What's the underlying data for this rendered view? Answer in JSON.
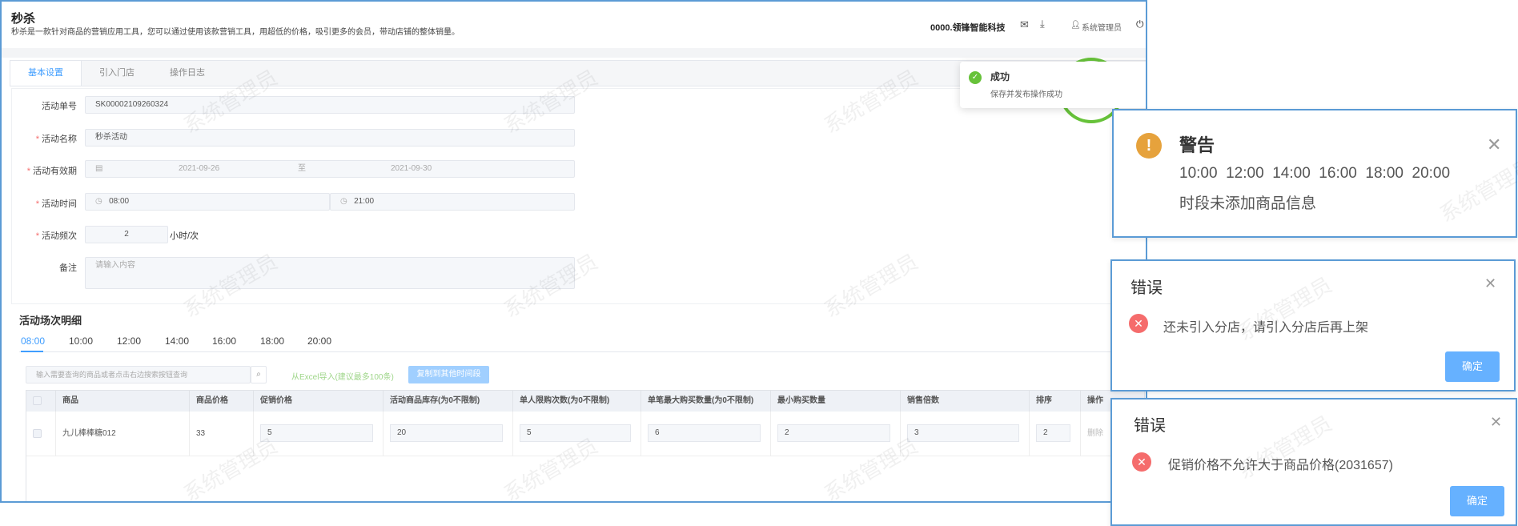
{
  "header": {
    "title": "秒杀",
    "subtitle": "秒杀是一款针对商品的营销应用工具，您可以通过使用该款营销工具，用超低的价格，吸引更多的会员，带动店铺的整体销量。",
    "company": "0000.领锋智能科技",
    "user": "系统管理员"
  },
  "tabs": [
    {
      "label": "基本设置"
    },
    {
      "label": "引入门店"
    },
    {
      "label": "操作日志"
    }
  ],
  "form": {
    "order_no_label": "活动单号",
    "order_no": "SK00002109260324",
    "name_label": "活动名称",
    "name": "秒杀活动",
    "period_label": "活动有效期",
    "start_date": "2021-09-26",
    "to": "至",
    "end_date": "2021-09-30",
    "time_label": "活动时间",
    "start_time": "08:00",
    "end_time": "21:00",
    "freq_label": "活动频次",
    "freq": "2",
    "freq_unit": "小时/次",
    "remark_label": "备注",
    "remark_placeholder": "请输入内容",
    "required_mark": "*"
  },
  "section": {
    "title": "活动场次明细",
    "time_tabs": [
      "08:00",
      "10:00",
      "12:00",
      "14:00",
      "16:00",
      "18:00",
      "20:00"
    ],
    "search_placeholder": "输入需要查询的商品或者点击右边搜索按钮查询",
    "excel_import": "从Excel导入(建议最多100条)",
    "copy_button": "复制到其他时间段"
  },
  "table": {
    "columns": [
      "商品",
      "商品价格",
      "促销价格",
      "活动商品库存(为0不限制)",
      "单人限购次数(为0不限制)",
      "单笔最大购买数量(为0不限制)",
      "最小购买数量",
      "销售倍数",
      "排序",
      "操作"
    ],
    "rows": [
      {
        "product": "九儿棒棒糖012",
        "price": "33",
        "promo_price": "5",
        "stock": "20",
        "per_user_limit": "5",
        "max_per_order": "6",
        "min_qty": "2",
        "multiple": "3",
        "sort": "2",
        "action": "删除"
      }
    ]
  },
  "watermark": "系统管理员",
  "toast": {
    "title": "成功",
    "message": "保存并发布操作成功"
  },
  "warning": {
    "title": "警告",
    "times": "10:00  12:00  14:00  16:00  18:00  20:00",
    "message": "时段未添加商品信息"
  },
  "errors": [
    {
      "title": "错误",
      "message": "还未引入分店，请引入分店后再上架",
      "ok": "确定"
    },
    {
      "title": "错误",
      "message": "促销价格不允许大于商品价格(2031657)",
      "ok": "确定"
    }
  ],
  "colors": {
    "accent": "#409eff",
    "success": "#67c23a",
    "warning": "#e6a23c",
    "error": "#f56c6c",
    "frame": "#5b9bd5"
  }
}
